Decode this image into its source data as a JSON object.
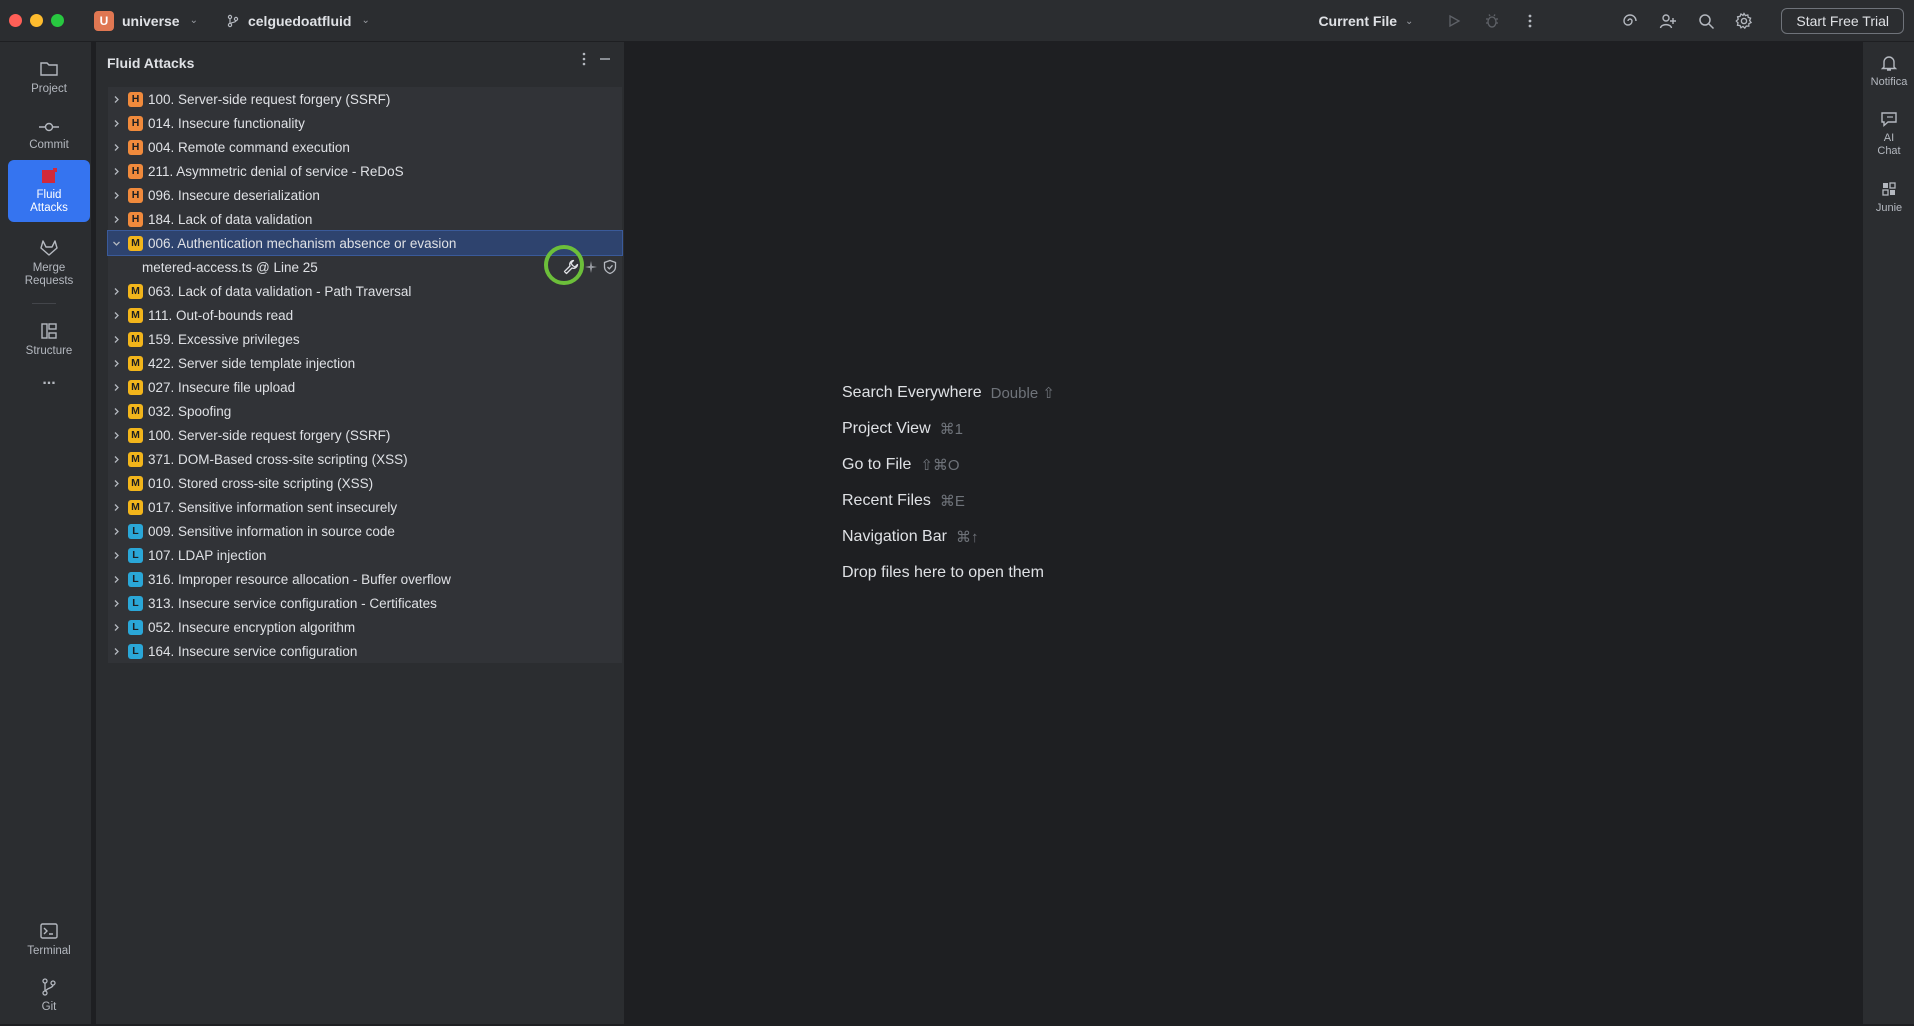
{
  "colors": {
    "severity_high": "#f08a3c",
    "severity_medium": "#f2b51b",
    "severity_low": "#2aa7d8",
    "accent": "#3574f0",
    "focus_ring": "#6cbf3a"
  },
  "titlebar": {
    "project_badge": "U",
    "project_name": "universe",
    "branch_name": "celguedoatfluid",
    "run_config": "Current File",
    "trial_button": "Start Free Trial"
  },
  "left_tools": {
    "project": "Project",
    "commit": "Commit",
    "fluid_attacks": "Fluid Attacks",
    "merge_requests": "Merge Requests",
    "structure": "Structure",
    "more": "...",
    "terminal": "Terminal",
    "git": "Git"
  },
  "panel": {
    "title": "Fluid Attacks",
    "child_file": "metered-access.ts @ Line 25",
    "items": [
      {
        "sev": "H",
        "label": "100. Server-side request forgery (SSRF)"
      },
      {
        "sev": "H",
        "label": "014. Insecure functionality"
      },
      {
        "sev": "H",
        "label": "004. Remote command execution"
      },
      {
        "sev": "H",
        "label": "211. Asymmetric denial of service - ReDoS"
      },
      {
        "sev": "H",
        "label": "096. Insecure deserialization"
      },
      {
        "sev": "H",
        "label": "184. Lack of data validation"
      },
      {
        "sev": "M",
        "label": "006. Authentication mechanism absence or evasion"
      },
      {
        "sev": "M",
        "label": "063. Lack of data validation - Path Traversal"
      },
      {
        "sev": "M",
        "label": "111. Out-of-bounds read"
      },
      {
        "sev": "M",
        "label": "159. Excessive privileges"
      },
      {
        "sev": "M",
        "label": "422. Server side template injection"
      },
      {
        "sev": "M",
        "label": "027. Insecure file upload"
      },
      {
        "sev": "M",
        "label": "032. Spoofing"
      },
      {
        "sev": "M",
        "label": "100. Server-side request forgery (SSRF)"
      },
      {
        "sev": "M",
        "label": "371. DOM-Based cross-site scripting (XSS)"
      },
      {
        "sev": "M",
        "label": "010. Stored cross-site scripting (XSS)"
      },
      {
        "sev": "M",
        "label": "017. Sensitive information sent insecurely"
      },
      {
        "sev": "L",
        "label": "009. Sensitive information in source code"
      },
      {
        "sev": "L",
        "label": "107. LDAP injection"
      },
      {
        "sev": "L",
        "label": "316. Improper resource allocation - Buffer overflow"
      },
      {
        "sev": "L",
        "label": "313. Insecure service configuration - Certificates"
      },
      {
        "sev": "L",
        "label": "052. Insecure encryption algorithm"
      },
      {
        "sev": "L",
        "label": "164. Insecure service configuration"
      }
    ]
  },
  "editor": {
    "hints": [
      {
        "label": "Search Everywhere",
        "key": "Double ⇧"
      },
      {
        "label": "Project View",
        "key": "⌘1"
      },
      {
        "label": "Go to File",
        "key": "⇧⌘O"
      },
      {
        "label": "Recent Files",
        "key": "⌘E"
      },
      {
        "label": "Navigation Bar",
        "key": "⌘↑"
      },
      {
        "label": "Drop files here to open them",
        "key": ""
      }
    ]
  },
  "right_tools": {
    "notifications": "Notifica",
    "ai_chat": "AI Chat",
    "junie": "Junie"
  }
}
